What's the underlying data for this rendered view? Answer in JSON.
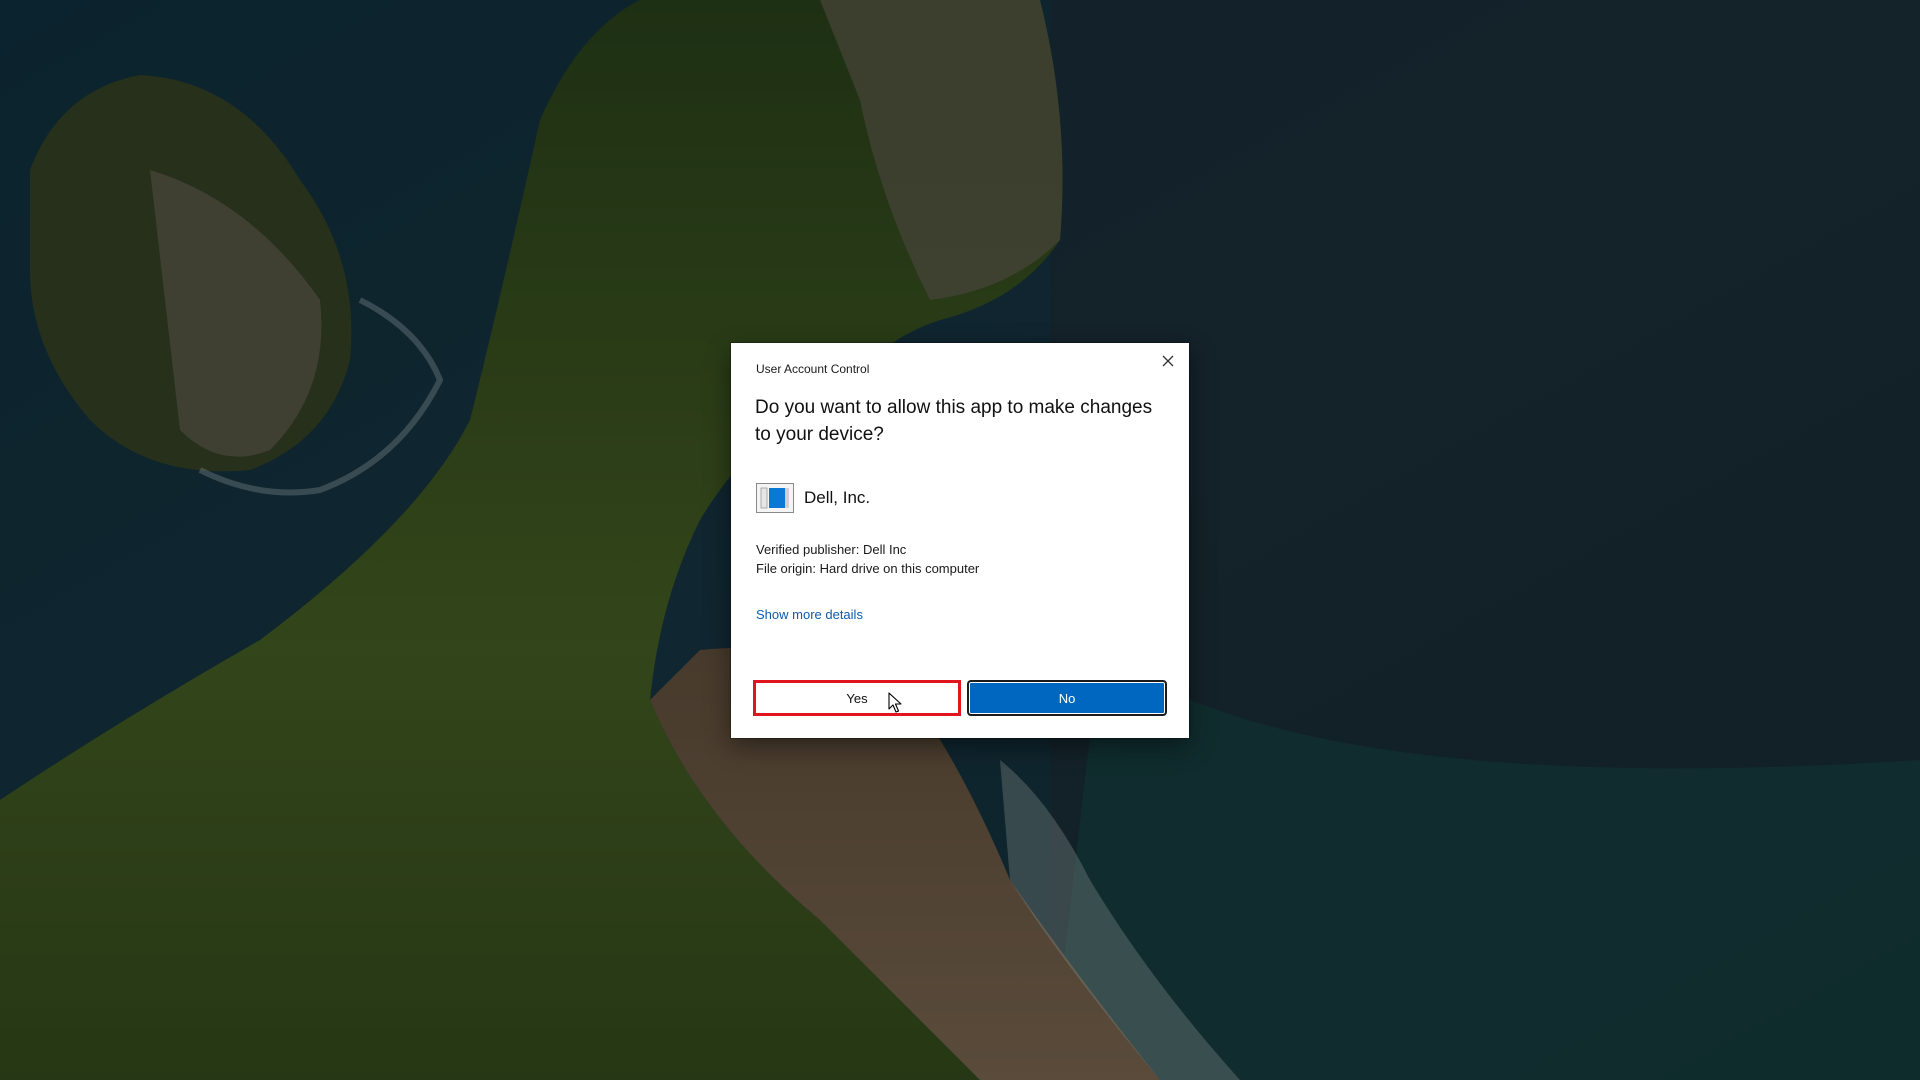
{
  "dialog": {
    "title": "User Account Control",
    "question": "Do you want to allow this app to make changes to your device?",
    "app_name": "Dell, Inc.",
    "verified_publisher": "Verified publisher: Dell Inc",
    "file_origin": "File origin: Hard drive on this computer",
    "more_details_link": "Show more details",
    "yes_label": "Yes",
    "no_label": "No",
    "close_icon": "close-icon",
    "app_icon": "application-icon"
  },
  "colors": {
    "primary_button": "#0067c0",
    "focus_outline": "#e0151d",
    "link": "#0b5cad"
  }
}
